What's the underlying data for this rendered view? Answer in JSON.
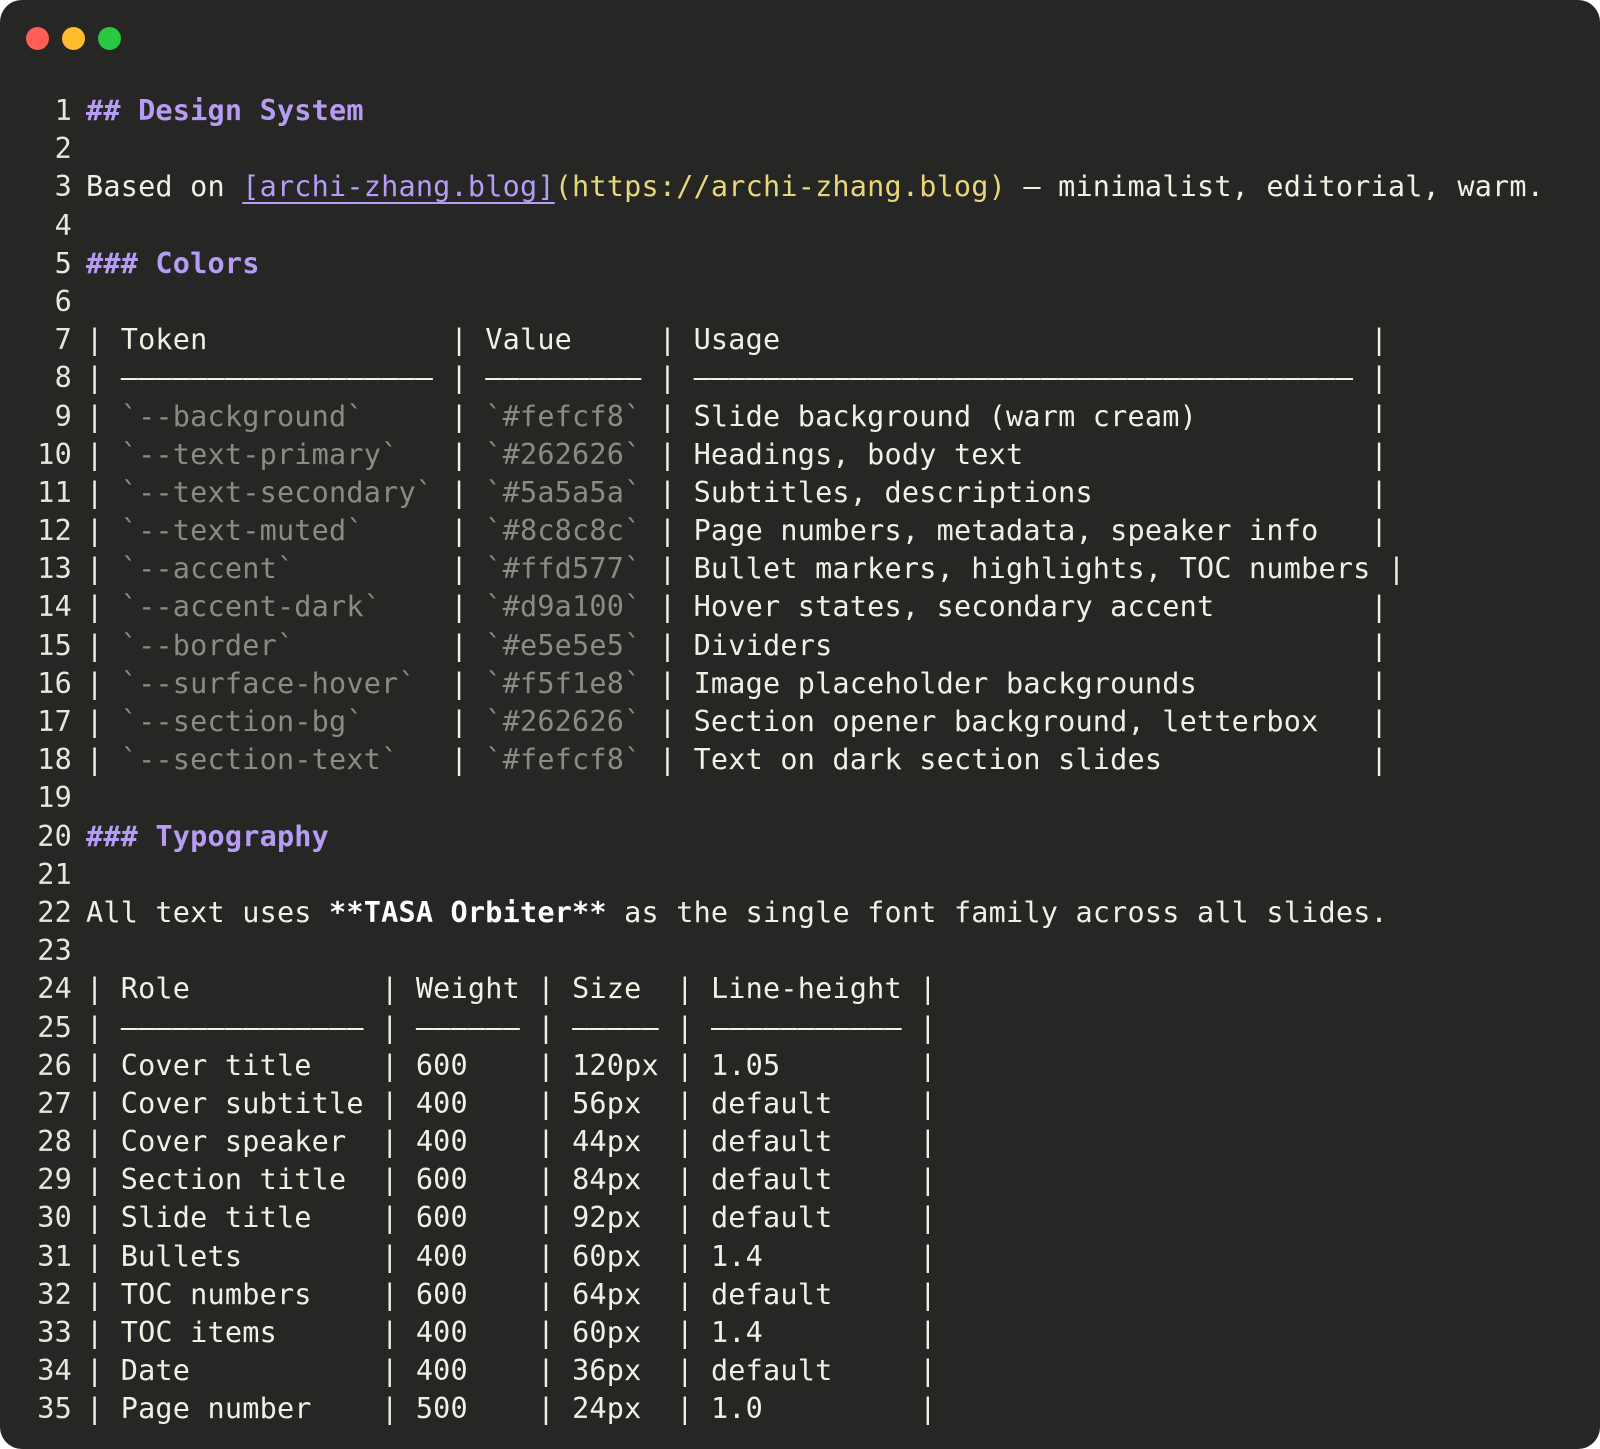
{
  "window": {
    "controls": [
      "close",
      "minimize",
      "maximize"
    ],
    "colors": {
      "background": "#262624",
      "heading": "#b79cf5",
      "link_url": "#e8d778",
      "code_span": "#8c8a84",
      "text": "#f2efe4",
      "close": "#ff5f57",
      "minimize": "#febc2e",
      "maximize": "#28c840"
    }
  },
  "doc": {
    "line_numbers": [
      "1",
      "2",
      "3",
      "4",
      "5",
      "6",
      "7",
      "8",
      "9",
      "10",
      "11",
      "12",
      "13",
      "14",
      "15",
      "16",
      "17",
      "18",
      "19",
      "20",
      "21",
      "22",
      "23",
      "24",
      "25",
      "26",
      "27",
      "28",
      "29",
      "30",
      "31",
      "32",
      "33",
      "34",
      "35"
    ],
    "h_design": "## Design System",
    "intro_prefix": "Based on ",
    "intro_link_text": "[archi-zhang.blog]",
    "intro_link_url": "(https://archi-zhang.blog)",
    "intro_suffix": " — minimalist, editorial, warm.",
    "h_colors": "### Colors",
    "colors_header": {
      "token": "Token",
      "value": "Value",
      "usage": "Usage"
    },
    "colors_rows": [
      {
        "token": "`--background`",
        "value": "`#fefcf8`",
        "usage": "Slide background (warm cream)"
      },
      {
        "token": "`--text-primary`",
        "value": "`#262626`",
        "usage": "Headings, body text"
      },
      {
        "token": "`--text-secondary`",
        "value": "`#5a5a5a`",
        "usage": "Subtitles, descriptions"
      },
      {
        "token": "`--text-muted`",
        "value": "`#8c8c8c`",
        "usage": "Page numbers, metadata, speaker info"
      },
      {
        "token": "`--accent`",
        "value": "`#ffd577`",
        "usage": "Bullet markers, highlights, TOC numbers"
      },
      {
        "token": "`--accent-dark`",
        "value": "`#d9a100`",
        "usage": "Hover states, secondary accent"
      },
      {
        "token": "`--border`",
        "value": "`#e5e5e5`",
        "usage": "Dividers"
      },
      {
        "token": "`--surface-hover`",
        "value": "`#f5f1e8`",
        "usage": "Image placeholder backgrounds"
      },
      {
        "token": "`--section-bg`",
        "value": "`#262626`",
        "usage": "Section opener background, letterbox"
      },
      {
        "token": "`--section-text`",
        "value": "`#fefcf8`",
        "usage": "Text on dark section slides"
      }
    ],
    "h_typography": "### Typography",
    "typo_intro_prefix": "All text uses ",
    "typo_intro_bold": "**TASA Orbiter**",
    "typo_intro_suffix": " as the single font family across all slides.",
    "typo_header": {
      "role": "Role",
      "weight": "Weight",
      "size": "Size",
      "line_height": "Line-height"
    },
    "typo_rows": [
      {
        "role": "Cover title",
        "weight": "600",
        "size": "120px",
        "line_height": "1.05"
      },
      {
        "role": "Cover subtitle",
        "weight": "400",
        "size": "56px",
        "line_height": "default"
      },
      {
        "role": "Cover speaker",
        "weight": "400",
        "size": "44px",
        "line_height": "default"
      },
      {
        "role": "Section title",
        "weight": "600",
        "size": "84px",
        "line_height": "default"
      },
      {
        "role": "Slide title",
        "weight": "600",
        "size": "92px",
        "line_height": "default"
      },
      {
        "role": "Bullets",
        "weight": "400",
        "size": "60px",
        "line_height": "1.4"
      },
      {
        "role": "TOC numbers",
        "weight": "600",
        "size": "64px",
        "line_height": "default"
      },
      {
        "role": "TOC items",
        "weight": "400",
        "size": "60px",
        "line_height": "1.4"
      },
      {
        "role": "Date",
        "weight": "400",
        "size": "36px",
        "line_height": "default"
      },
      {
        "role": "Page number",
        "weight": "500",
        "size": "24px",
        "line_height": "1.0"
      }
    ]
  }
}
